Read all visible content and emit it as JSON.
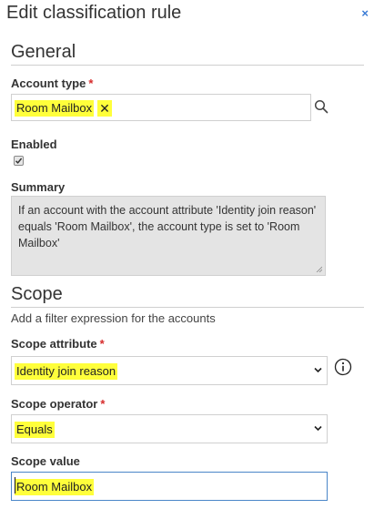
{
  "dialog": {
    "title": "Edit classification rule",
    "close_symbol": "×"
  },
  "general": {
    "heading": "General",
    "account_type": {
      "label": "Account type",
      "required_mark": "*",
      "selected_tag": "Room Mailbox",
      "remove_symbol": "✕"
    },
    "enabled": {
      "label": "Enabled",
      "checked": true
    },
    "summary": {
      "label": "Summary",
      "text": "If an account with the account attribute 'Identity join reason' equals 'Room Mailbox', the account type is set to 'Room Mailbox'"
    }
  },
  "scope": {
    "heading": "Scope",
    "hint": "Add a filter expression for the accounts",
    "attribute": {
      "label": "Scope attribute",
      "required_mark": "*",
      "value": "Identity join reason"
    },
    "operator": {
      "label": "Scope operator",
      "required_mark": "*",
      "value": "Equals"
    },
    "value_field": {
      "label": "Scope value",
      "value": "Room Mailbox"
    }
  },
  "icons": {
    "close": "close-icon",
    "search": "search-icon",
    "checkbox": "checkmark-icon",
    "dropdown": "chevron-down-icon",
    "info": "info-icon",
    "resize": "resize-grip-icon"
  },
  "colors": {
    "highlight": "#ffff3b",
    "required": "#d62b2b",
    "accent": "#3a7bd5",
    "summary_bg": "#e4e4e4"
  }
}
